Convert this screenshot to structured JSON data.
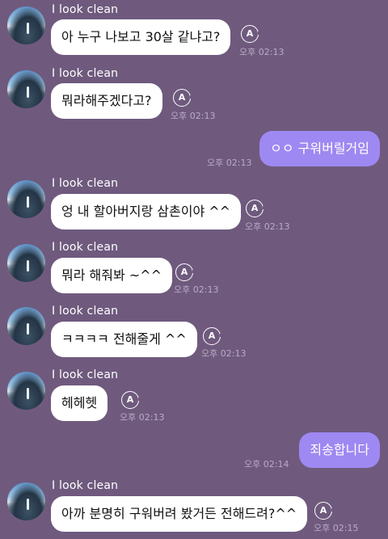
{
  "sender_name": "I look clean",
  "translate_glyph": "A",
  "colors": {
    "background": "#6f5a7e",
    "incoming_bubble": "#ffffff",
    "outgoing_bubble": "#9e88f2",
    "time_text": "#b9abc6"
  },
  "messages": [
    {
      "from": "other",
      "text": "아 누구 나보고 30살 같냐고?",
      "time": "오후 02:13"
    },
    {
      "from": "other",
      "text": "뭐라해주겠다고?",
      "time": "오후 02:13"
    },
    {
      "from": "me",
      "text": "ㅇㅇ 구워버릴거임",
      "time": "오후 02:13"
    },
    {
      "from": "other",
      "text": "엉 내 할아버지랑 삼촌이야 ^^",
      "time": "오후 02:13"
    },
    {
      "from": "other",
      "text": "뭐라 해줘봐 ~^^",
      "time": "오후 02:13"
    },
    {
      "from": "other",
      "text": "ㅋㅋㅋㅋ 전해줄게 ^^",
      "time": "오후 02:13"
    },
    {
      "from": "other",
      "text": "헤헤헷",
      "time": "오후 02:13"
    },
    {
      "from": "me",
      "text": "죄송합니다",
      "time": "오후 02:14"
    },
    {
      "from": "other",
      "text": "아까 분명히 구워버려 봤거든 전해드려?^^",
      "time": "오후 02:15"
    }
  ]
}
